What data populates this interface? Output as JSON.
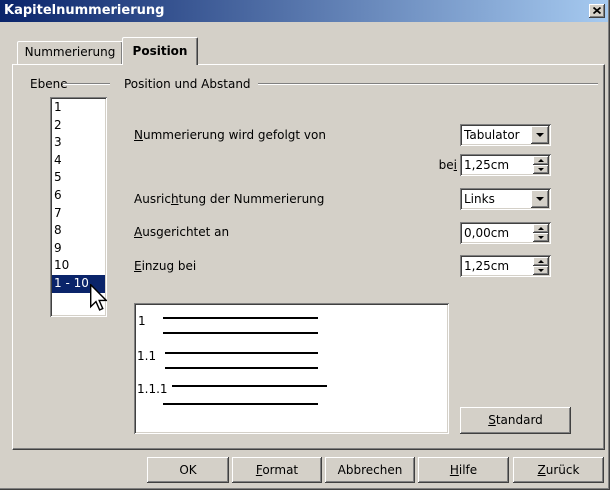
{
  "window": {
    "title": "Kapitelnummerierung"
  },
  "tabs": [
    {
      "label": "Nummerierung",
      "active": false
    },
    {
      "label": "Position",
      "active": true
    }
  ],
  "level": {
    "group_label": "Ebene",
    "items": [
      "1",
      "2",
      "3",
      "4",
      "5",
      "6",
      "7",
      "8",
      "9",
      "10",
      "1 - 10"
    ],
    "selected_index": 10
  },
  "position": {
    "group_label": "Position und Abstand",
    "followed_by": {
      "label": "Nummerierung wird gefolgt von",
      "value": "Tabulator"
    },
    "tab_at": {
      "label": "bei",
      "value": "1,25cm"
    },
    "alignment": {
      "label": "Ausrichtung der Nummerierung",
      "value": "Links"
    },
    "aligned_at": {
      "label": "Ausgerichtet an",
      "value": "0,00cm"
    },
    "indent_at": {
      "label": "Einzug bei",
      "value": "1,25cm"
    },
    "standard_button": "Standard"
  },
  "preview": {
    "labels": [
      "1",
      "1.1",
      "1.1.1"
    ]
  },
  "buttons": {
    "ok": "OK",
    "format": "Format",
    "cancel": "Abbrechen",
    "help": "Hilfe",
    "back": "Zurück"
  },
  "icons": [
    "close-icon",
    "chevron-down-icon",
    "spin-up-icon",
    "spin-down-icon",
    "mouse-cursor-icon"
  ],
  "colors": {
    "face": "#d4d0c8",
    "titlebar_start": "#0a246a",
    "titlebar_end": "#a6caf0",
    "selection": "#0a246a",
    "selection_text": "#ffffff"
  }
}
